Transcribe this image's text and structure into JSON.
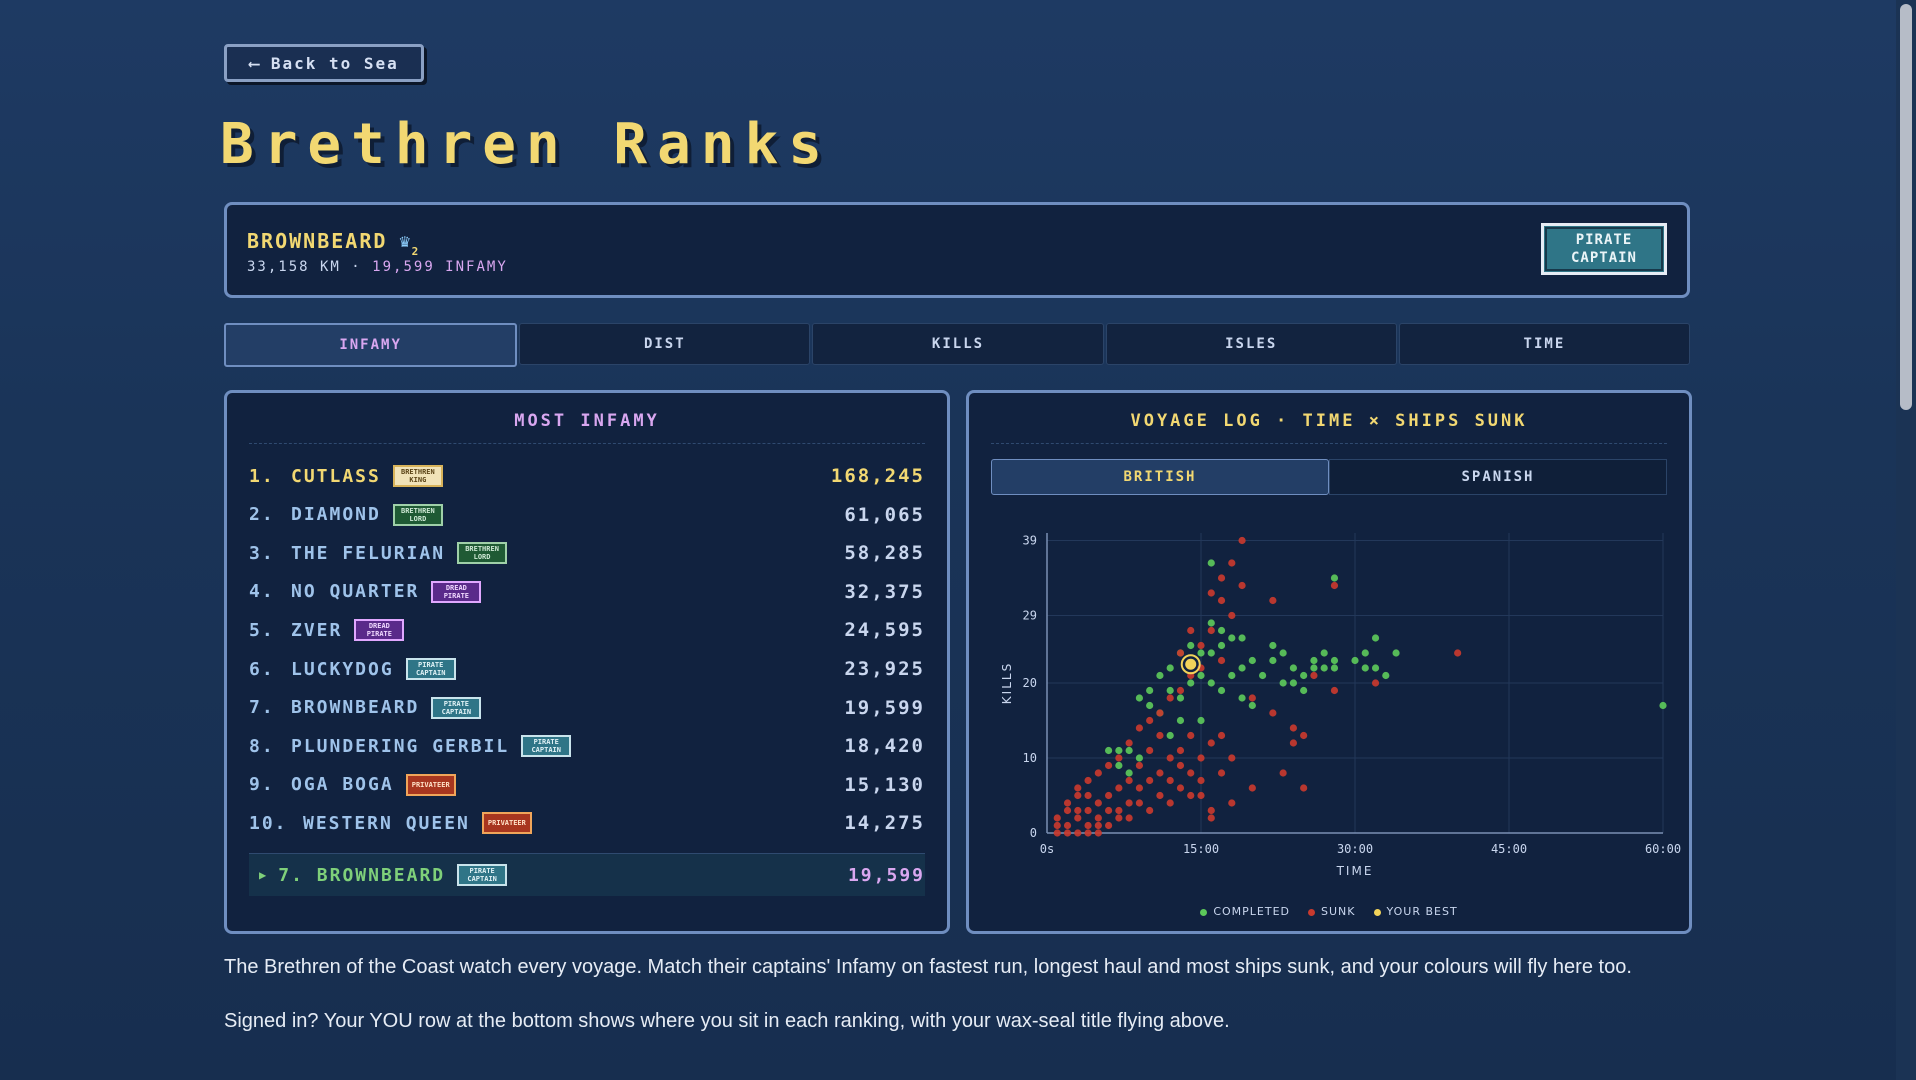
{
  "nav": {
    "back_label": "Back to Sea",
    "back_icon": "arrow-left-icon"
  },
  "title": "Brethren Ranks",
  "player": {
    "name": "BROWNBEARD",
    "crown_count": "2",
    "distance": "33,158 KM",
    "separator": "·",
    "infamy": "19,599 INFAMY",
    "rank_title": "PIRATE\nCAPTAIN"
  },
  "tabs": [
    {
      "label": "INFAMY",
      "active": true
    },
    {
      "label": "DIST",
      "active": false
    },
    {
      "label": "KILLS",
      "active": false
    },
    {
      "label": "ISLES",
      "active": false
    },
    {
      "label": "TIME",
      "active": false
    }
  ],
  "leaderboard": {
    "heading": "MOST INFAMY",
    "rows": [
      {
        "rank": "1.",
        "name": "CUTLASS",
        "badge": "BRETHREN\nKING",
        "badge_type": "king",
        "value": "168,245"
      },
      {
        "rank": "2.",
        "name": "DIAMOND",
        "badge": "BRETHREN\nLORD",
        "badge_type": "lord",
        "value": "61,065"
      },
      {
        "rank": "3.",
        "name": "THE FELURIAN",
        "badge": "BRETHREN\nLORD",
        "badge_type": "lord",
        "value": "58,285"
      },
      {
        "rank": "4.",
        "name": "NO QUARTER",
        "badge": "DREAD\nPIRATE",
        "badge_type": "dread",
        "value": "32,375"
      },
      {
        "rank": "5.",
        "name": "ZVER",
        "badge": "DREAD\nPIRATE",
        "badge_type": "dread",
        "value": "24,595"
      },
      {
        "rank": "6.",
        "name": "LUCKYDOG",
        "badge": "PIRATE\nCAPTAIN",
        "badge_type": "captain",
        "value": "23,925"
      },
      {
        "rank": "7.",
        "name": "BROWNBEARD",
        "badge": "PIRATE\nCAPTAIN",
        "badge_type": "captain",
        "value": "19,599"
      },
      {
        "rank": "8.",
        "name": "PLUNDERING GERBIL",
        "badge": "PIRATE\nCAPTAIN",
        "badge_type": "captain",
        "value": "18,420"
      },
      {
        "rank": "9.",
        "name": "OGA BOGA",
        "badge": "PRIVATEER",
        "badge_type": "privateer",
        "value": "15,130"
      },
      {
        "rank": "10.",
        "name": "WESTERN QUEEN",
        "badge": "PRIVATEER",
        "badge_type": "privateer",
        "value": "14,275"
      }
    ],
    "you": {
      "rank": "7.",
      "name": "BROWNBEARD",
      "badge": "PIRATE\nCAPTAIN",
      "value": "19,599"
    }
  },
  "voyage": {
    "heading": "VOYAGE LOG · TIME × SHIPS SUNK",
    "subtabs": [
      {
        "label": "BRITISH",
        "active": true
      },
      {
        "label": "SPANISH",
        "active": false
      }
    ],
    "legend": [
      {
        "label": "COMPLETED",
        "color": "#5cc85a"
      },
      {
        "label": "SUNK",
        "color": "#c83a2e"
      },
      {
        "label": "YOUR BEST",
        "color": "#f2d35a"
      }
    ]
  },
  "chart_data": {
    "type": "scatter",
    "xlabel": "TIME",
    "ylabel": "KILLS",
    "xlim": [
      0,
      60
    ],
    "ylim": [
      0,
      40
    ],
    "x_ticks": [
      "0s",
      "15:00",
      "30:00",
      "45:00",
      "60:00"
    ],
    "y_ticks": [
      "0",
      "10",
      "20",
      "29",
      "39"
    ],
    "grid": true,
    "legend_position": "bottom",
    "series": [
      {
        "name": "COMPLETED",
        "color": "#5cc85a",
        "points": [
          [
            16,
            36
          ],
          [
            16,
            28
          ],
          [
            17,
            27
          ],
          [
            17,
            25
          ],
          [
            18,
            26
          ],
          [
            19,
            26
          ],
          [
            16,
            24
          ],
          [
            15,
            24
          ],
          [
            14,
            25
          ],
          [
            13,
            24
          ],
          [
            12,
            22
          ],
          [
            11,
            21
          ],
          [
            12,
            19
          ],
          [
            13,
            18
          ],
          [
            10,
            19
          ],
          [
            9,
            18
          ],
          [
            10,
            17
          ],
          [
            11,
            16
          ],
          [
            14,
            20
          ],
          [
            15,
            21
          ],
          [
            16,
            20
          ],
          [
            17,
            19
          ],
          [
            18,
            21
          ],
          [
            19,
            18
          ],
          [
            20,
            17
          ],
          [
            19,
            22
          ],
          [
            20,
            23
          ],
          [
            22,
            23
          ],
          [
            22,
            25
          ],
          [
            23,
            24
          ],
          [
            24,
            22
          ],
          [
            25,
            21
          ],
          [
            26,
            22
          ],
          [
            26,
            23
          ],
          [
            27,
            24
          ],
          [
            28,
            23
          ],
          [
            25,
            19
          ],
          [
            24,
            20
          ],
          [
            23,
            20
          ],
          [
            21,
            21
          ],
          [
            27,
            22
          ],
          [
            28,
            22
          ],
          [
            30,
            23
          ],
          [
            31,
            24
          ],
          [
            31,
            22
          ],
          [
            32,
            22
          ],
          [
            32,
            26
          ],
          [
            33,
            21
          ],
          [
            34,
            24
          ],
          [
            28,
            34
          ],
          [
            60,
            17
          ],
          [
            8,
            11
          ],
          [
            7,
            11
          ],
          [
            6,
            11
          ],
          [
            7,
            9
          ],
          [
            8,
            8
          ],
          [
            9,
            10
          ],
          [
            12,
            13
          ],
          [
            13,
            15
          ],
          [
            15,
            15
          ]
        ]
      },
      {
        "name": "SUNK",
        "color": "#c83a2e",
        "points": [
          [
            19,
            39
          ],
          [
            18,
            36
          ],
          [
            17,
            34
          ],
          [
            19,
            33
          ],
          [
            16,
            32
          ],
          [
            17,
            31
          ],
          [
            22,
            31
          ],
          [
            18,
            29
          ],
          [
            16,
            27
          ],
          [
            15,
            25
          ],
          [
            14,
            27
          ],
          [
            13,
            24
          ],
          [
            17,
            23
          ],
          [
            15,
            22
          ],
          [
            14,
            21
          ],
          [
            13,
            19
          ],
          [
            12,
            18
          ],
          [
            11,
            16
          ],
          [
            10,
            15
          ],
          [
            9,
            14
          ],
          [
            8,
            12
          ],
          [
            7,
            10
          ],
          [
            6,
            9
          ],
          [
            5,
            8
          ],
          [
            4,
            7
          ],
          [
            3,
            6
          ],
          [
            3,
            5
          ],
          [
            2,
            4
          ],
          [
            2,
            3
          ],
          [
            1,
            2
          ],
          [
            1,
            1
          ],
          [
            1,
            0
          ],
          [
            2,
            0
          ],
          [
            3,
            0
          ],
          [
            4,
            0
          ],
          [
            5,
            0
          ],
          [
            2,
            1
          ],
          [
            3,
            2
          ],
          [
            4,
            3
          ],
          [
            5,
            2
          ],
          [
            6,
            1
          ],
          [
            7,
            3
          ],
          [
            8,
            2
          ],
          [
            9,
            4
          ],
          [
            10,
            3
          ],
          [
            11,
            5
          ],
          [
            12,
            4
          ],
          [
            13,
            6
          ],
          [
            14,
            5
          ],
          [
            15,
            7
          ],
          [
            16,
            3
          ],
          [
            17,
            8
          ],
          [
            12,
            10
          ],
          [
            13,
            11
          ],
          [
            14,
            13
          ],
          [
            11,
            13
          ],
          [
            10,
            11
          ],
          [
            9,
            9
          ],
          [
            8,
            7
          ],
          [
            7,
            6
          ],
          [
            6,
            5
          ],
          [
            5,
            4
          ],
          [
            4,
            5
          ],
          [
            3,
            3
          ],
          [
            4,
            1
          ],
          [
            5,
            1
          ],
          [
            6,
            3
          ],
          [
            7,
            2
          ],
          [
            8,
            4
          ],
          [
            9,
            6
          ],
          [
            10,
            7
          ],
          [
            11,
            8
          ],
          [
            12,
            7
          ],
          [
            13,
            9
          ],
          [
            14,
            8
          ],
          [
            15,
            10
          ],
          [
            16,
            12
          ],
          [
            17,
            13
          ],
          [
            18,
            10
          ],
          [
            24,
            14
          ],
          [
            25,
            13
          ],
          [
            25,
            6
          ],
          [
            28,
            33
          ],
          [
            32,
            20
          ],
          [
            40,
            24
          ],
          [
            26,
            21
          ],
          [
            28,
            19
          ],
          [
            20,
            18
          ],
          [
            22,
            16
          ],
          [
            24,
            12
          ],
          [
            23,
            8
          ],
          [
            20,
            6
          ],
          [
            18,
            4
          ],
          [
            16,
            2
          ],
          [
            15,
            5
          ]
        ]
      },
      {
        "name": "YOUR BEST",
        "color": "#f2d35a",
        "points": [
          [
            14,
            22.5
          ]
        ]
      }
    ]
  },
  "description": {
    "line1": "The Brethren of the Coast watch every voyage. Match their captains' Infamy on fastest run, longest haul and most ships sunk, and your colours will fly here too.",
    "line2": "Signed in? Your YOU row at the bottom shows where you sit in each ranking, with your wax-seal title flying above."
  }
}
